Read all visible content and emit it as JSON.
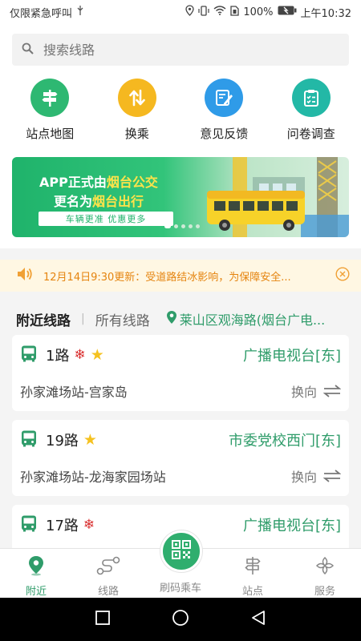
{
  "status_bar": {
    "left_text": "仅限紧急呼叫",
    "battery": "100%",
    "time": "上午10:32"
  },
  "search": {
    "placeholder": "搜索线路"
  },
  "quick_actions": [
    {
      "label": "站点地图",
      "icon": "signpost-icon",
      "color": "#2eb872"
    },
    {
      "label": "换乘",
      "icon": "transfer-arrows-icon",
      "color": "#f5b820"
    },
    {
      "label": "意见反馈",
      "icon": "feedback-edit-icon",
      "color": "#2f9be8"
    },
    {
      "label": "问卷调查",
      "icon": "clipboard-checklist-icon",
      "color": "#23b8a6"
    }
  ],
  "banner": {
    "line1_prefix": "APP正式由",
    "line1_highlight": "烟台公交",
    "line2_prefix": "更名为",
    "line2_highlight": "烟台出行",
    "slogan": "车辆更准  优惠更多",
    "slides": 5,
    "active_slide": 1
  },
  "notice": {
    "text": "12月14日9:30更新：受道路结冰影响，为保障安全...",
    "icon": "speaker-icon"
  },
  "route_tabs": {
    "nearby": "附近线路",
    "all": "所有线路",
    "location": "莱山区观海路(烟台广电..."
  },
  "routes": [
    {
      "name": "1路",
      "snow": true,
      "star": true,
      "destination": "广播电视台[东]",
      "stops": "孙家滩场站-宫家岛",
      "swap_label": "换向"
    },
    {
      "name": "19路",
      "snow": false,
      "star": true,
      "destination": "市委党校西门[东]",
      "stops": "孙家滩场站-龙海家园场站",
      "swap_label": "换向"
    },
    {
      "name": "17路",
      "snow": true,
      "star": false,
      "destination": "广播电视台[东]",
      "stops": "",
      "swap_label": ""
    }
  ],
  "symbols": {
    "snow": "❄",
    "star": "★"
  },
  "bottom_nav": [
    {
      "label": "附近",
      "icon": "location-pin-icon",
      "active": true
    },
    {
      "label": "线路",
      "icon": "route-icon",
      "active": false
    },
    {
      "label": "刷码乘车",
      "icon": "qr-code-icon",
      "active": false
    },
    {
      "label": "站点",
      "icon": "signpost-icon",
      "active": false
    },
    {
      "label": "服务",
      "icon": "services-grid-icon",
      "active": false
    }
  ],
  "colors": {
    "accent_green": "#2f9c6a",
    "notice_orange": "#e5840f",
    "snow_red": "#d93030",
    "star_yellow": "#f5c220"
  }
}
